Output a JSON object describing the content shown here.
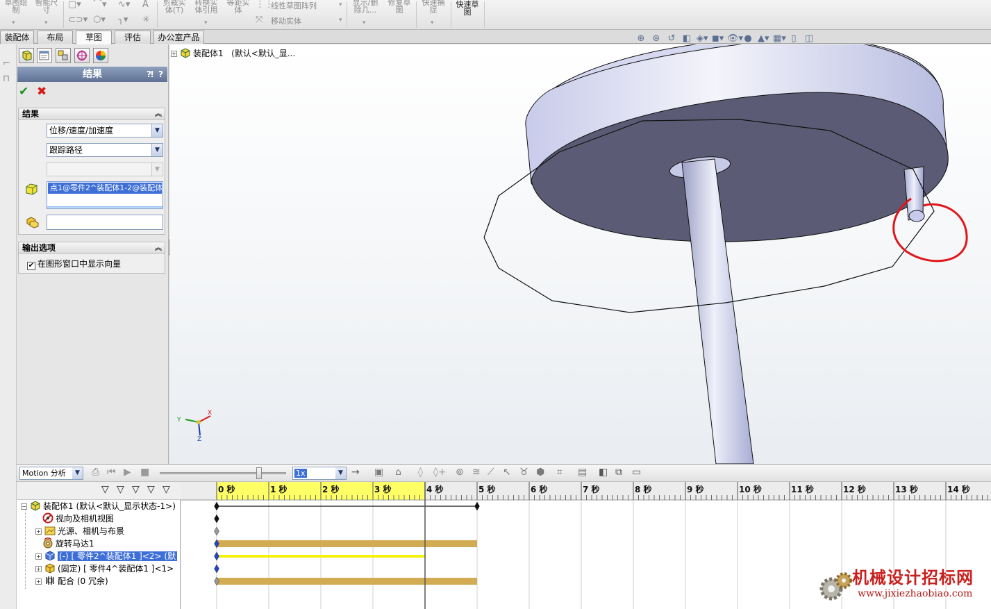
{
  "ribbon": {
    "buttons": [
      {
        "label": "草图绘\n制"
      },
      {
        "label": "智能尺\n寸"
      },
      {
        "label": "剪裁实\n体(T)"
      },
      {
        "label": "转换实\n体引用"
      },
      {
        "label": "等距实\n体"
      },
      {
        "label": "显示/删\n除几..."
      },
      {
        "label": "修复草\n图"
      },
      {
        "label": "快速捕\n捉"
      },
      {
        "label": "快速草\n图"
      }
    ],
    "linear_pattern": "线性草图阵列",
    "move_entities": "移动实体"
  },
  "command_tabs": [
    "装配体",
    "布局",
    "草图",
    "评估",
    "办公室产品"
  ],
  "active_tab": "草图",
  "property_manager": {
    "title": "结果",
    "help": "?",
    "group_results": "结果",
    "select_category": "位移/速度/加速度",
    "select_subtype": "跟踪路径",
    "select_component": "",
    "selection_entity": "点1@零件2^装配体1-2@装配体1",
    "reference_field": "",
    "group_output": "输出选项",
    "show_vector_checkbox": "在图形窗口中显示向量"
  },
  "feature_tree": {
    "root_label": "装配体1",
    "root_config": "(默认<默认_显..."
  },
  "triad": {
    "x": "X",
    "y": "Y",
    "z": "Z"
  },
  "motion": {
    "study_type": "Motion 分析",
    "playback_speed": "1x",
    "seconds": [
      "0 秒",
      "1 秒",
      "2 秒",
      "3 秒",
      "4 秒",
      "5 秒",
      "6 秒",
      "7 秒",
      "8 秒",
      "9 秒",
      "10 秒",
      "11 秒",
      "12 秒",
      "13 秒",
      "14 秒"
    ],
    "tree": [
      {
        "label": "装配体1   (默认<默认_显示状态-1>)",
        "expander": "−"
      },
      {
        "label": "视向及相机视图",
        "expander": ""
      },
      {
        "label": "光源、相机与布景",
        "expander": "+"
      },
      {
        "label": "旋转马达1",
        "expander": ""
      },
      {
        "label": "(-) [ 零件2^装配体1 ]<2> (默",
        "expander": "+"
      },
      {
        "label": "(固定) [ 零件4^装配体1 ]<1>",
        "expander": "+"
      },
      {
        "label": "配合  (0 冗余)",
        "expander": "+"
      }
    ],
    "timeline_end_seconds": 5,
    "playhead_seconds": 4,
    "highlight_end_seconds": 4
  },
  "watermark": {
    "cn": "机械设计招标网",
    "url": "www.jixiezhaobiao.com"
  },
  "colors": {
    "accent": "#5f7194",
    "timeline_bar": "#d2ac52",
    "highlight": "#ffff66",
    "annotation": "#e0161a"
  }
}
